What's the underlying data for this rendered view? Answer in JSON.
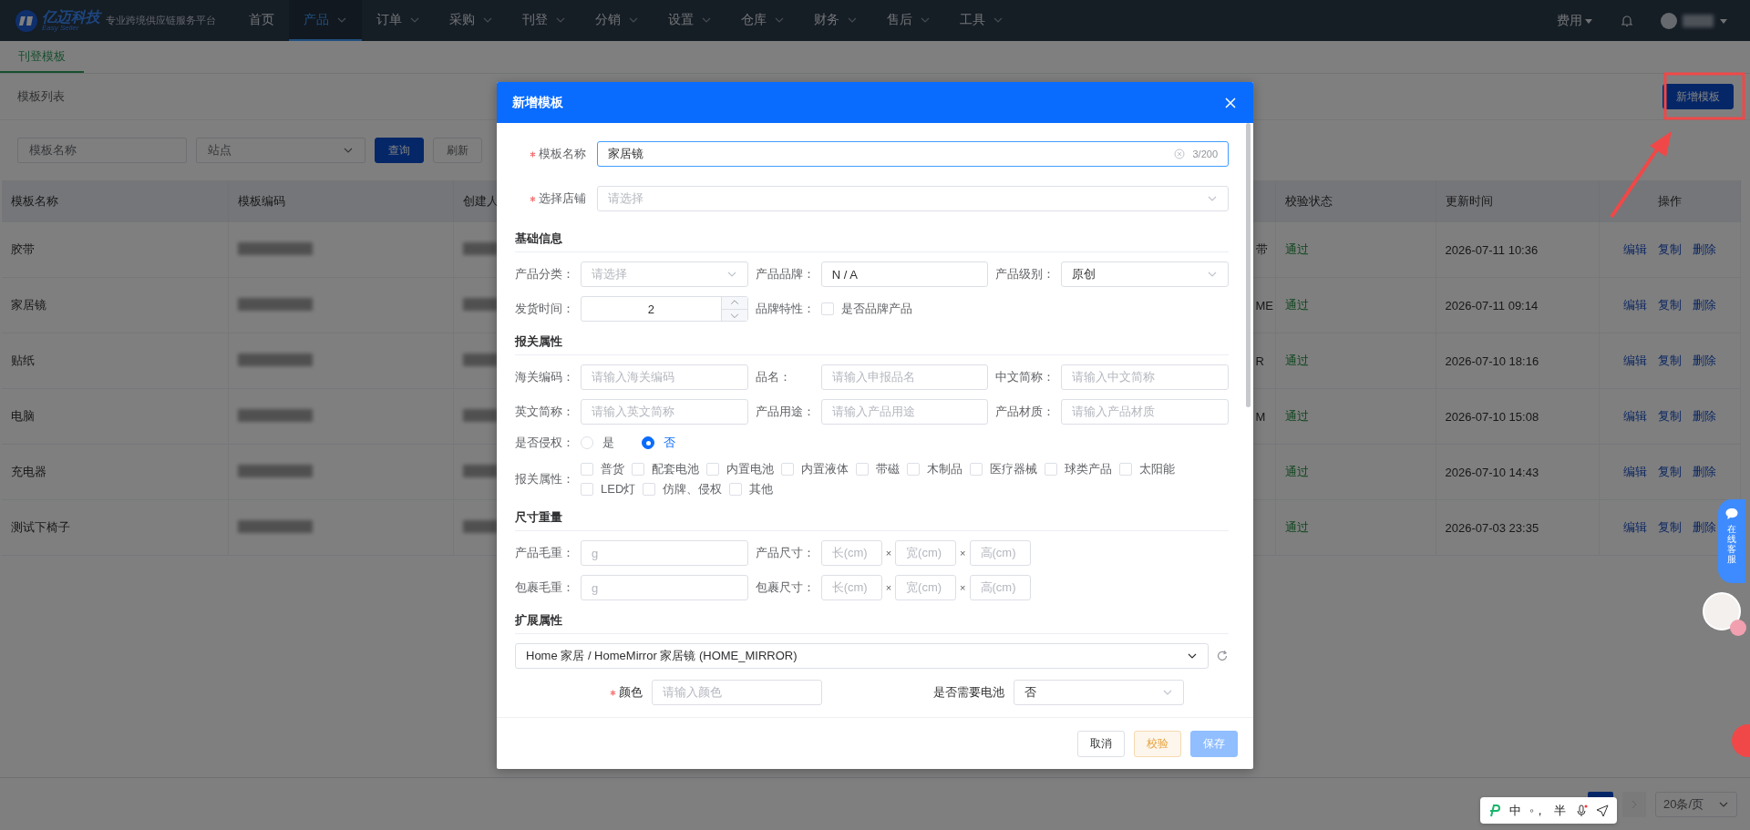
{
  "nav": {
    "logo_text": "亿迈科技",
    "logo_subtext": "Easy Seller",
    "slogan": "专业跨境供应链服务平台",
    "items": [
      {
        "label": "首页",
        "dropdown": false,
        "selected": false
      },
      {
        "label": "产品",
        "dropdown": true,
        "selected": true
      },
      {
        "label": "订单",
        "dropdown": true,
        "selected": false
      },
      {
        "label": "采购",
        "dropdown": true,
        "selected": false
      },
      {
        "label": "刊登",
        "dropdown": true,
        "selected": false
      },
      {
        "label": "分销",
        "dropdown": true,
        "selected": false
      },
      {
        "label": "设置",
        "dropdown": true,
        "selected": false
      },
      {
        "label": "仓库",
        "dropdown": true,
        "selected": false
      },
      {
        "label": "财务",
        "dropdown": true,
        "selected": false
      },
      {
        "label": "售后",
        "dropdown": true,
        "selected": false
      },
      {
        "label": "工具",
        "dropdown": true,
        "selected": false
      }
    ],
    "fee_menu": "费用"
  },
  "page_tabs": [
    {
      "label": "刊登模板",
      "selected": true
    }
  ],
  "list_header": {
    "title": "模板列表",
    "add_button": "新增模板"
  },
  "filters": {
    "name_placeholder": "模板名称",
    "site_placeholder": "站点",
    "query_button": "查询",
    "refresh_button": "刷新"
  },
  "table": {
    "columns": [
      "模板名称",
      "模板编码",
      "创建人",
      "校验状态",
      "更新时间",
      "操作"
    ],
    "rows": [
      {
        "name": "胶带",
        "column_4": "带",
        "status": "通过",
        "updated": "2026-07-11 10:36",
        "actions": [
          "编辑",
          "复制",
          "删除"
        ]
      },
      {
        "name": "家居镜",
        "column_4": "ME",
        "status": "通过",
        "updated": "2026-07-11 09:14",
        "actions": [
          "编辑",
          "复制",
          "删除"
        ]
      },
      {
        "name": "贴纸",
        "column_4": "R",
        "status": "通过",
        "updated": "2026-07-10 18:16",
        "actions": [
          "编辑",
          "复制",
          "删除"
        ]
      },
      {
        "name": "电脑",
        "column_4": "M",
        "status": "通过",
        "updated": "2026-07-10 15:08",
        "actions": [
          "编辑",
          "复制",
          "删除"
        ]
      },
      {
        "name": "充电器",
        "status": "通过",
        "updated": "2026-07-10 14:43",
        "actions": [
          "编辑",
          "复制",
          "删除"
        ]
      },
      {
        "name": "测试下椅子",
        "status": "通过",
        "updated": "2026-07-03 23:35",
        "actions": [
          "编辑",
          "复制",
          "删除"
        ]
      }
    ]
  },
  "pagination": {
    "page_size": "20条/页"
  },
  "modal": {
    "title": "新增模板",
    "top_fields": [
      {
        "label": "模板名称",
        "required": true,
        "kind": "text",
        "value": "家居镜",
        "count": "3/200",
        "focused": true
      },
      {
        "label": "选择店铺",
        "required": true,
        "kind": "select",
        "placeholder": "请选择",
        "focused": false
      }
    ],
    "sections": [
      {
        "title": "基础信息",
        "fields": [
          {
            "kind": "select",
            "label": "产品分类：",
            "placeholder": "请选择"
          },
          {
            "kind": "text",
            "label": "产品品牌：",
            "value": "N / A"
          },
          {
            "kind": "select",
            "label": "产品级别：",
            "value": "原创"
          },
          {
            "kind": "number",
            "label": "发货时间：",
            "value": "2"
          },
          {
            "kind": "checkbox",
            "label": "品牌特性：",
            "option": "是否品牌产品",
            "checked": false
          }
        ]
      },
      {
        "title": "报关属性",
        "fields": [
          {
            "kind": "text",
            "label": "海关编码：",
            "placeholder": "请输入海关编码"
          },
          {
            "kind": "text",
            "label": "品名：",
            "placeholder": "请输入申报品名"
          },
          {
            "kind": "text",
            "label": "中文简称：",
            "placeholder": "请输入中文简称"
          },
          {
            "kind": "text",
            "label": "英文简称：",
            "placeholder": "请输入英文简称"
          },
          {
            "kind": "text",
            "label": "产品用途：",
            "placeholder": "请输入产品用途"
          },
          {
            "kind": "text",
            "label": "产品材质：",
            "placeholder": "请输入产品材质"
          },
          {
            "kind": "radio",
            "label": "是否侵权：",
            "options": [
              {
                "label": "是",
                "selected": false
              },
              {
                "label": "否",
                "selected": true
              }
            ]
          },
          {
            "kind": "checkbox_group",
            "label": "报关属性：",
            "options": [
              {
                "label": "普货",
                "checked": false
              },
              {
                "label": "配套电池",
                "checked": false
              },
              {
                "label": "内置电池",
                "checked": false
              },
              {
                "label": "内置液体",
                "checked": false
              },
              {
                "label": "带磁",
                "checked": false
              },
              {
                "label": "木制品",
                "checked": false
              },
              {
                "label": "医疗器械",
                "checked": false
              },
              {
                "label": "球类产品",
                "checked": false
              },
              {
                "label": "太阳能",
                "checked": false
              },
              {
                "label": "LED灯",
                "checked": false
              },
              {
                "label": "仿牌、侵权",
                "checked": false
              },
              {
                "label": "其他",
                "checked": false
              }
            ]
          }
        ]
      },
      {
        "title": "尺寸重量",
        "fields": [
          {
            "kind": "text",
            "label": "产品毛重：",
            "placeholder": "g"
          },
          {
            "kind": "dims",
            "label": "产品尺寸：",
            "placeholders": [
              "长(cm)",
              "宽(cm)",
              "高(cm)"
            ],
            "separators": [
              "×",
              "×"
            ]
          },
          {
            "kind": "text",
            "label": "包裹毛重：",
            "placeholder": "g"
          },
          {
            "kind": "dims",
            "label": "包裹尺寸：",
            "placeholders": [
              "长(cm)",
              "宽(cm)",
              "高(cm)"
            ],
            "separators": [
              "×",
              "×"
            ]
          }
        ]
      },
      {
        "title": "扩展属性",
        "fields": [
          {
            "kind": "cascader",
            "value": "Home 家居 / HomeMirror 家居镜 (HOME_MIRROR)"
          },
          {
            "kind": "text",
            "label": "颜色",
            "required": true,
            "placeholder": "请输入颜色"
          },
          {
            "kind": "select",
            "label": "是否需要电池",
            "value": "否"
          }
        ]
      }
    ],
    "buttons": [
      {
        "label": "取消",
        "kind": "default",
        "disabled": false
      },
      {
        "label": "校验",
        "kind": "warning",
        "disabled": false
      },
      {
        "label": "保存",
        "kind": "primary",
        "disabled": true
      }
    ]
  },
  "ime_toolbar": {
    "items": [
      "中",
      "◦，",
      "半"
    ]
  },
  "chat_widget": {
    "label": "在线客服"
  }
}
